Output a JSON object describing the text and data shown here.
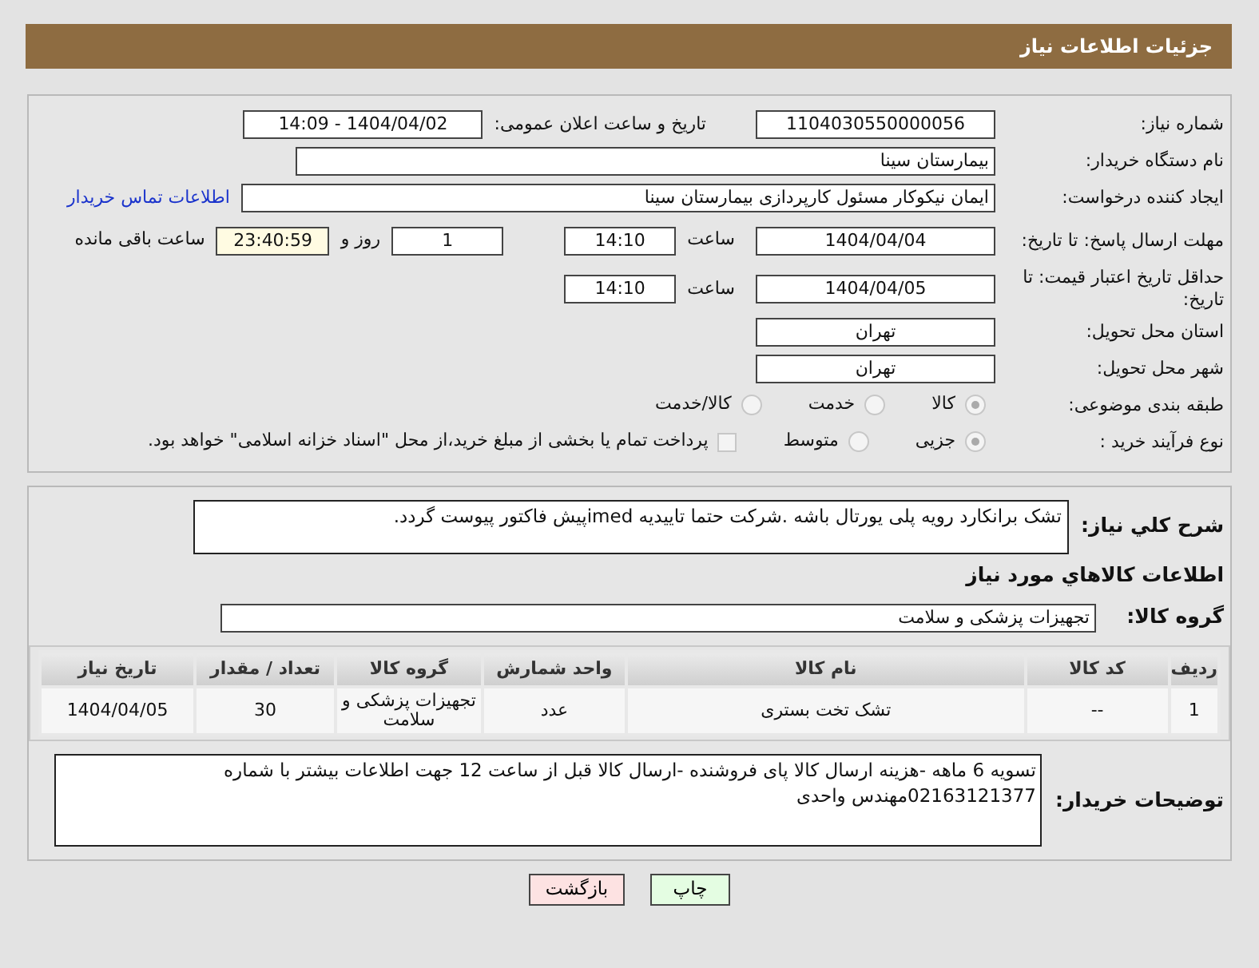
{
  "header": {
    "title": "جزئیات اطلاعات نیاز"
  },
  "details": [
    {
      "label": "شماره نیاز:",
      "items": [
        {
          "kind": "date",
          "value": "1104030550000056"
        },
        {
          "kind": "text",
          "value": "تاریخ و ساعت اعلان عمومی:"
        },
        {
          "kind": "date",
          "value": "1404/04/02 - 14:09"
        }
      ]
    },
    {
      "label": "نام دستگاه خریدار:",
      "items": [
        {
          "kind": "name",
          "value": "بیمارستان سینا"
        }
      ]
    },
    {
      "label": "ایجاد کننده درخواست:",
      "items": [
        {
          "kind": "name",
          "value": "ایمان نیکوکار مسئول کارپردازی  بیمارستان سینا"
        },
        {
          "kind": "link",
          "value": "اطلاعات تماس خریدار"
        }
      ]
    },
    {
      "label": "مهلت ارسال پاسخ: تا تاریخ:",
      "items": [
        {
          "kind": "date",
          "value": "1404/04/04"
        },
        {
          "kind": "text",
          "value": "ساعت"
        },
        {
          "kind": "time",
          "value": "14:10"
        },
        {
          "kind": "time",
          "value": "1"
        },
        {
          "kind": "text",
          "value": "روز و"
        },
        {
          "kind": "remaining",
          "value": "23:40:59"
        },
        {
          "kind": "text",
          "value": "ساعت باقی مانده"
        }
      ]
    },
    {
      "label": "حداقل تاریخ اعتبار قیمت: تا تاریخ:",
      "items": [
        {
          "kind": "date",
          "value": "1404/04/05"
        },
        {
          "kind": "text",
          "value": "ساعت"
        },
        {
          "kind": "time",
          "value": "14:10"
        }
      ]
    },
    {
      "label": "استان محل تحویل:",
      "items": [
        {
          "kind": "date",
          "value": "تهران"
        }
      ]
    },
    {
      "label": "شهر محل تحویل:",
      "items": [
        {
          "kind": "date",
          "value": "تهران"
        }
      ]
    },
    {
      "label": "طبقه بندی موضوعی:",
      "items": [
        {
          "kind": "radio",
          "value": "کالا",
          "selected": true
        },
        {
          "kind": "radio",
          "value": "خدمت",
          "selected": false
        },
        {
          "kind": "radio",
          "value": "کالا/خدمت",
          "selected": false
        }
      ]
    },
    {
      "label": "نوع فرآیند خرید :",
      "items": [
        {
          "kind": "radio",
          "value": "جزیی",
          "selected": true
        },
        {
          "kind": "radio",
          "value": "متوسط",
          "selected": false
        },
        {
          "kind": "checkbox",
          "value": "پرداخت تمام یا بخشی از مبلغ خرید،از محل \"اسناد خزانه اسلامی\" خواهد بود.",
          "checked": false
        }
      ]
    }
  ],
  "description": {
    "label": "شرح کلي نياز:",
    "value": "تشک برانکارد رویه پلی یورتال باشه .شرکت حتما تاییدیه imedپیش فاکتور پیوست گردد."
  },
  "goods_title": "اطلاعات کالاهاي مورد نياز",
  "goods_group": {
    "label": "گروه کالا:",
    "value": "تجهیزات پزشکی و سلامت"
  },
  "table": {
    "columns": [
      "ردیف",
      "کد کالا",
      "نام کالا",
      "واحد شمارش",
      "گروه کالا",
      "تعداد / مقدار",
      "تاریخ نیاز"
    ],
    "rows": [
      [
        "1",
        "--",
        "تشک تخت بستری",
        "عدد",
        "تجهیزات پزشکی و سلامت",
        "30",
        "1404/04/05"
      ]
    ]
  },
  "buyer_notes": {
    "label": "توضیحات خریدار:",
    "value": "تسویه 6 ماهه -هزینه ارسال کالا پای فروشنده -ارسال کالا قبل از ساعت 12 جهت اطلاعات بیشتر با شماره 02163121377مهندس واحدی"
  },
  "buttons": [
    {
      "kind": "print",
      "label": "چاپ"
    },
    {
      "kind": "back",
      "label": "بازگشت"
    }
  ]
}
